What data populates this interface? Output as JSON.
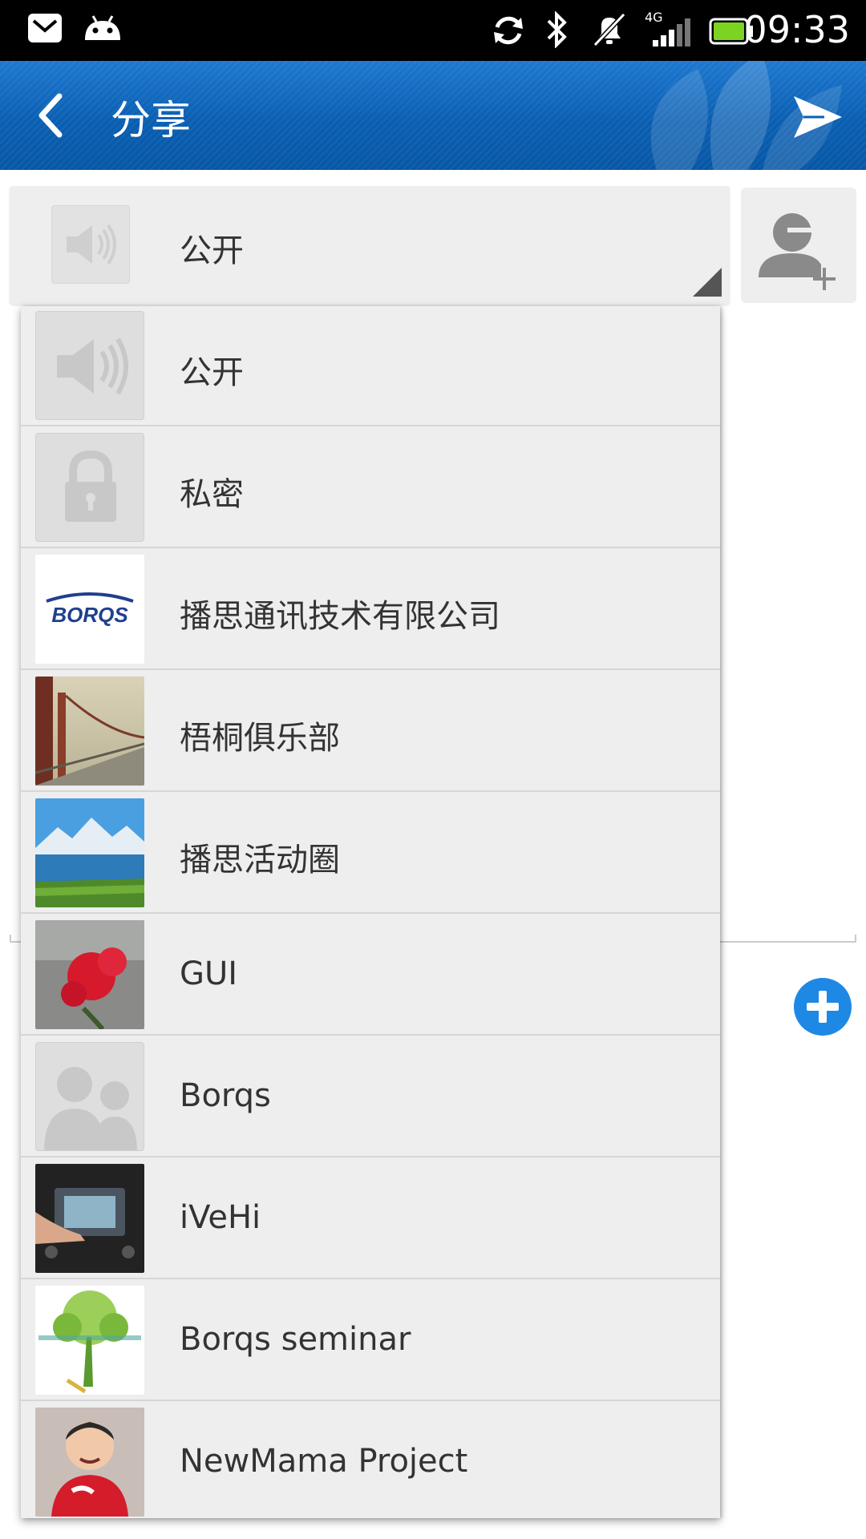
{
  "status_bar": {
    "time": "09:33",
    "network": "4G",
    "icons": [
      "mail-icon",
      "android-icon",
      "sync-icon",
      "bluetooth-icon",
      "mute-icon",
      "signal-icon",
      "battery-icon"
    ],
    "battery_color": "#7dd321"
  },
  "app_bar": {
    "title": "分享",
    "back_icon": "back-arrow-icon",
    "send_icon": "send-icon",
    "color": "#0a5fb2"
  },
  "visibility_spinner": {
    "selected_label": "公开",
    "icon": "speaker-icon"
  },
  "add_contact_button": {
    "icon": "add-person-icon"
  },
  "plus_button": {
    "icon": "plus-icon",
    "color": "#1e88e5"
  },
  "dropdown": {
    "items": [
      {
        "label": "公开",
        "icon": "speaker-icon"
      },
      {
        "label": "私密",
        "icon": "lock-icon"
      },
      {
        "label": "播思通讯技术有限公司",
        "icon": "borqs-logo",
        "logo_text": "BORQS"
      },
      {
        "label": "梧桐俱乐部",
        "icon": "bridge-photo"
      },
      {
        "label": "播思活动圈",
        "icon": "mountain-lake-photo"
      },
      {
        "label": "GUI",
        "icon": "red-flower-photo"
      },
      {
        "label": "Borqs",
        "icon": "group-avatar-icon"
      },
      {
        "label": "iVeHi",
        "icon": "car-dashboard-photo"
      },
      {
        "label": "Borqs seminar",
        "icon": "tree-drawing-photo"
      },
      {
        "label": "NewMama Project",
        "icon": "baby-photo"
      }
    ]
  }
}
